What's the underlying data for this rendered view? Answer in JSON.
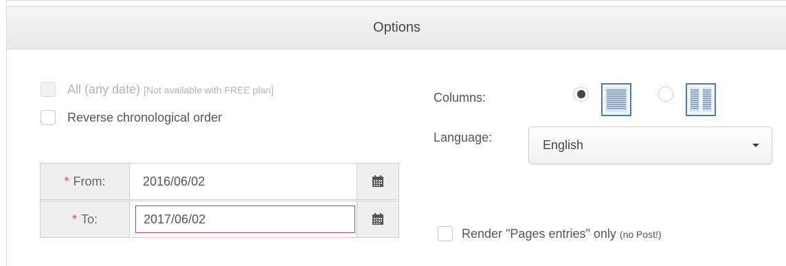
{
  "panel": {
    "title": "Options"
  },
  "date_options": {
    "all_label": "All (any date)",
    "all_note": "[Not available with FREE plan]",
    "reverse_label": "Reverse chronological order"
  },
  "date_range": {
    "required_mark": "*",
    "from_label": "From:",
    "from_value": "2016/06/02",
    "to_label": "To:",
    "to_value": "2017/06/02"
  },
  "columns": {
    "label": "Columns:",
    "options": [
      {
        "name": "single-column",
        "selected": true
      },
      {
        "name": "two-column",
        "selected": false
      }
    ]
  },
  "language": {
    "label": "Language:",
    "selected": "English"
  },
  "pages_only": {
    "label": "Render \"Pages entries\" only",
    "note": "(no Post!)"
  },
  "colors": {
    "required": "#d9534f",
    "invalid_border": "#b94a48",
    "header_bg": "#ececec"
  },
  "icons": {
    "calendar": "calendar-icon",
    "single_column": "page-single-column-icon",
    "two_column": "page-two-column-icon",
    "caret": "caret-down-icon"
  }
}
